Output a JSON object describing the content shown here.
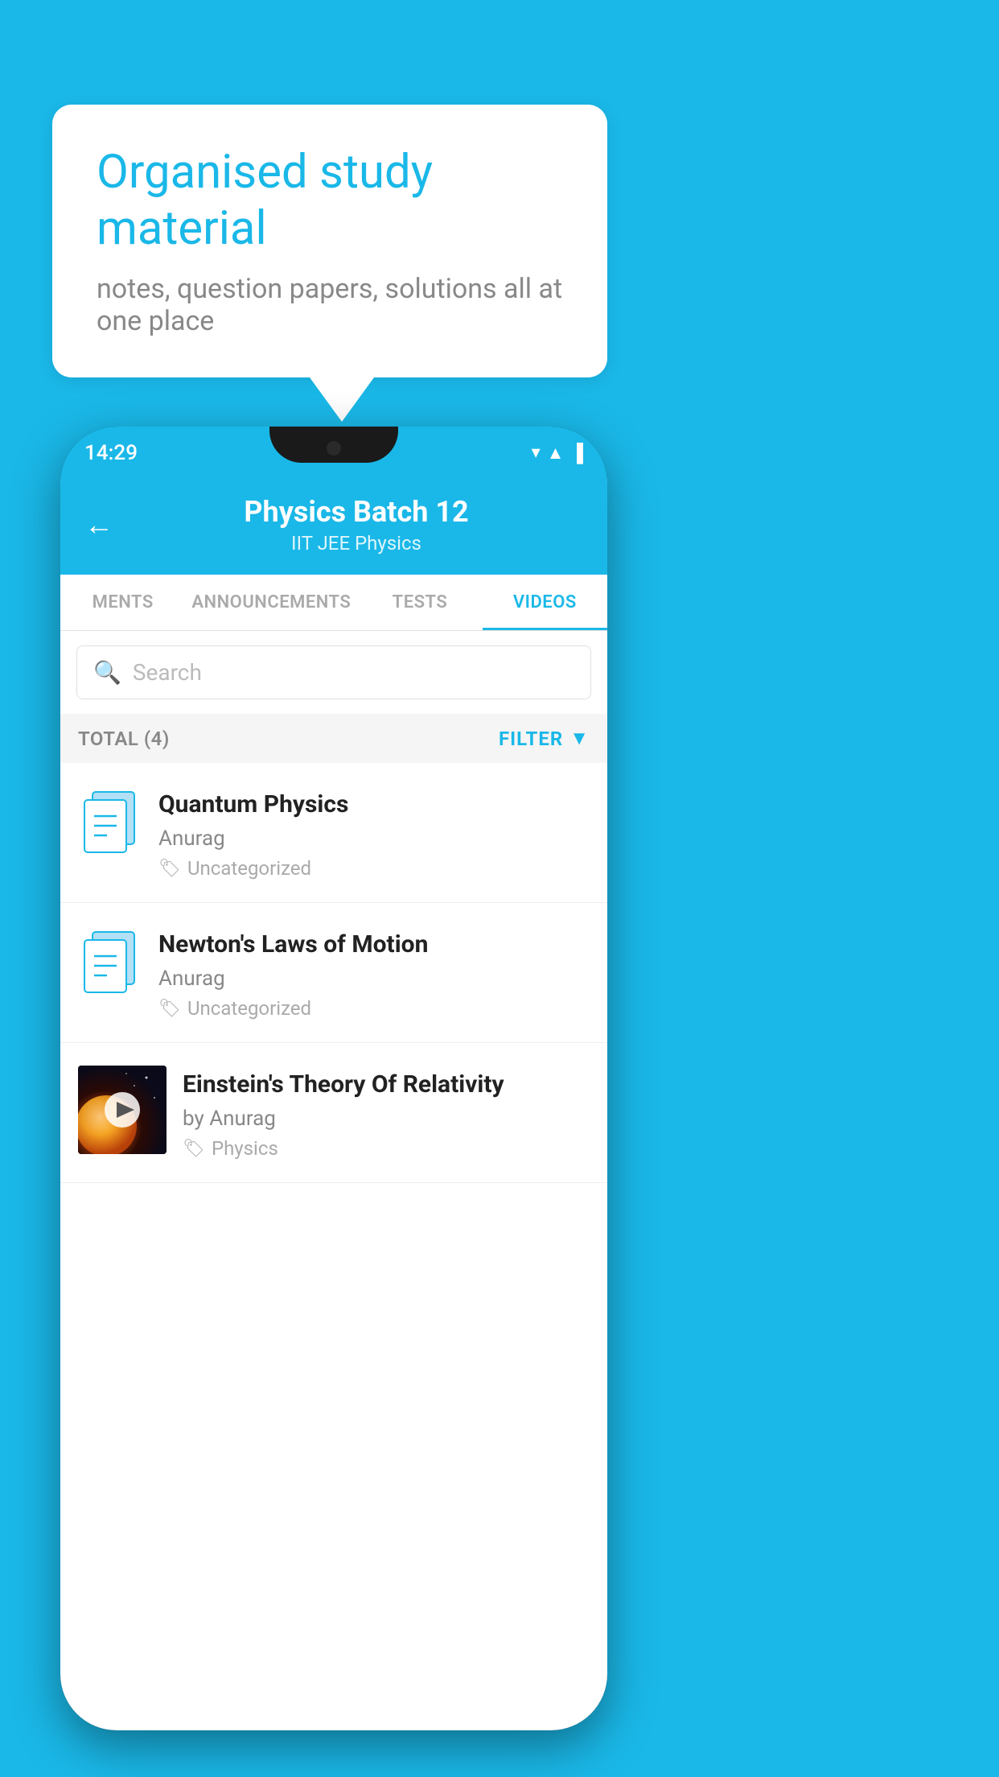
{
  "background_color": "#1ab8e8",
  "speech_bubble": {
    "title": "Organised study material",
    "subtitle": "notes, question papers, solutions all at one place"
  },
  "phone": {
    "status_bar": {
      "time": "14:29",
      "icons": [
        "wifi",
        "signal",
        "battery"
      ]
    },
    "header": {
      "title": "Physics Batch 12",
      "subtitle": "IIT JEE    Physics",
      "back_label": "←"
    },
    "tabs": [
      {
        "label": "MENTS",
        "active": false
      },
      {
        "label": "ANNOUNCEMENTS",
        "active": false
      },
      {
        "label": "TESTS",
        "active": false
      },
      {
        "label": "VIDEOS",
        "active": true
      }
    ],
    "search": {
      "placeholder": "Search"
    },
    "filter_bar": {
      "total_label": "TOTAL (4)",
      "filter_label": "FILTER"
    },
    "videos": [
      {
        "title": "Quantum Physics",
        "author": "Anurag",
        "tag": "Uncategorized",
        "has_thumbnail": false
      },
      {
        "title": "Newton's Laws of Motion",
        "author": "Anurag",
        "tag": "Uncategorized",
        "has_thumbnail": false
      },
      {
        "title": "Einstein's Theory Of Relativity",
        "author": "by Anurag",
        "tag": "Physics",
        "has_thumbnail": true
      }
    ]
  }
}
